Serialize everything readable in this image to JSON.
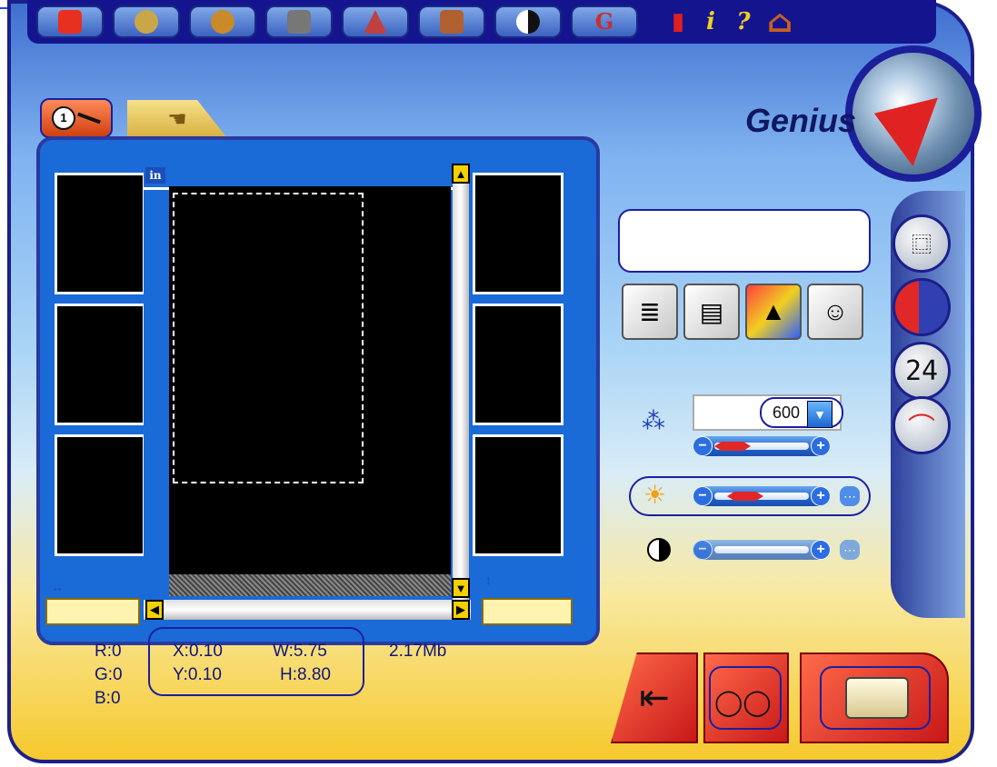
{
  "toolbar": {
    "buttons": [
      {
        "name": "scan-refresh-icon",
        "color": "#e83020"
      },
      {
        "name": "gear-sun-icon",
        "color": "#c9a648"
      },
      {
        "name": "sphere-icon",
        "color": "#c98a2a"
      },
      {
        "name": "window-icon",
        "color": "#666666"
      },
      {
        "name": "pyramid-icon",
        "color": "#c04040"
      },
      {
        "name": "arch-icon",
        "color": "#b06030"
      },
      {
        "name": "contrast-circle-icon",
        "color": "#111111"
      },
      {
        "name": "g-letter-icon",
        "color": "#c83030"
      }
    ],
    "tools": [
      {
        "name": "exit-door-small-icon",
        "glyph": "▮"
      },
      {
        "name": "info-icon",
        "glyph": "i"
      },
      {
        "name": "help-icon",
        "glyph": "?"
      },
      {
        "name": "home-icon",
        "glyph": "⌂"
      }
    ]
  },
  "brand": {
    "logo_text": "Genius"
  },
  "preview": {
    "units": "in",
    "tabs": [
      "1"
    ]
  },
  "info": {
    "r": "R:0",
    "g": "G:0",
    "b": "B:0",
    "x": "X:0.10",
    "y": "Y:0.10",
    "w": "W:5.75",
    "h": "H:8.80",
    "size": "2.17Mb"
  },
  "settings": {
    "resolution": "600",
    "bit_depth": "24"
  },
  "colors": {
    "accent": "#1b1f9a",
    "panel": "#1a6ad8",
    "bottom": "#d82020"
  }
}
